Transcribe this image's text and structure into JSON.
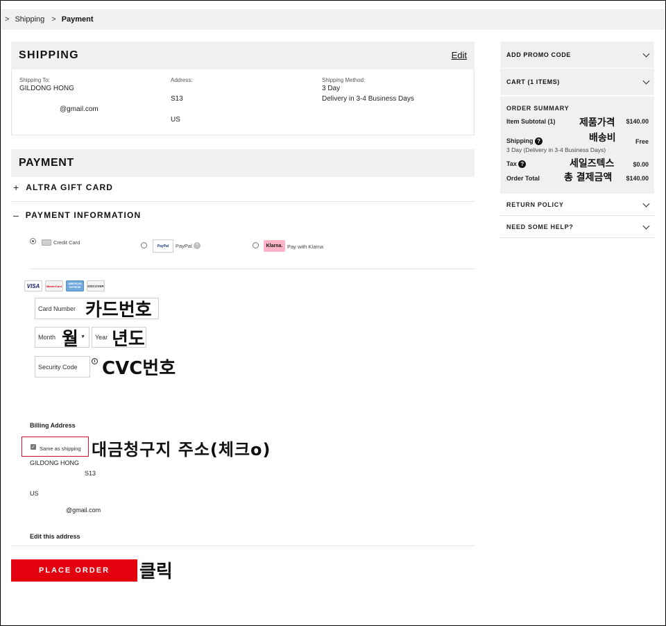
{
  "breadcrumb": {
    "items": [
      "Shipping",
      "Payment"
    ]
  },
  "shipping": {
    "title": "SHIPPING",
    "edit_label": "Edit",
    "to_label": "Shipping To:",
    "to_name": "GILDONG HONG",
    "to_email": "@gmail.com",
    "address_label": "Address:",
    "address_line": "S13",
    "address_country": "US",
    "method_label": "Shipping Method:",
    "method_name": "3 Day",
    "method_detail": "Delivery in 3-4 Business Days"
  },
  "payment": {
    "title": "PAYMENT",
    "gift_card": {
      "toggle": "+",
      "label": "ALTRA GIFT CARD"
    },
    "payment_info": {
      "toggle": "–",
      "label": "PAYMENT INFORMATION"
    },
    "methods": [
      {
        "label": "Credit Card",
        "selected": true
      },
      {
        "label": "PayPal",
        "selected": false
      },
      {
        "label": "Pay with Klarna",
        "selected": false
      }
    ],
    "paypal_logo": "PayPal",
    "klarna_logo": "Klarna.",
    "card_logos": [
      "VISA",
      "MasterCard",
      "AMERICAN EXPRESS",
      "DISCOVER"
    ],
    "card_number_placeholder": "Card Number",
    "month_placeholder": "Month",
    "year_placeholder": "Year",
    "security_placeholder": "Security Code",
    "info_icon": "i",
    "help_icon": "?"
  },
  "billing": {
    "title": "Billing Address",
    "same_as_shipping": "Same as shipping",
    "checked": true,
    "name": "GILDONG  HONG",
    "line": "S13",
    "country": "US",
    "email": "@gmail.com",
    "edit_label": "Edit this address"
  },
  "place_order_label": "PLACE ORDER",
  "annotations": {
    "card_number": "카드번호",
    "month": "월",
    "year": "년도",
    "cvc": "CVC번호",
    "billing": "대금청구지 주소(체크o)",
    "click": "클릭",
    "item_price": "제품가격",
    "shipping_fee": "배송비",
    "sales_tax": "세일즈텍스",
    "total": "총 결제금액"
  },
  "sidebar": {
    "promo": "ADD PROMO CODE",
    "cart": "CART (1 ITEMS)",
    "summary_title": "ORDER SUMMARY",
    "subtotal_label": "Item Subtotal (1)",
    "subtotal_value": "$140.00",
    "shipping_label": "Shipping",
    "shipping_value": "Free",
    "shipping_detail": "3 Day (Delivery in 3-4 Business Days)",
    "tax_label": "Tax",
    "tax_value": "$0.00",
    "total_label": "Order Total",
    "total_value": "$140.00",
    "return_policy": "RETURN POLICY",
    "help": "NEED SOME HELP?"
  },
  "colors": {
    "accent": "#e3000f",
    "panel": "#f0f0f0",
    "highlight_border": "#c8102e",
    "klarna_bg": "#ffb3c7"
  }
}
